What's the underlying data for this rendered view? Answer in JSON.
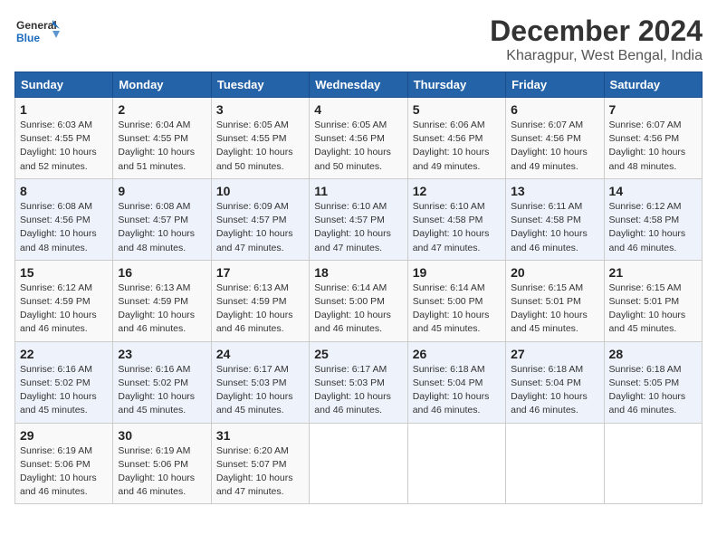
{
  "logo": {
    "line1": "General",
    "line2": "Blue"
  },
  "title": "December 2024",
  "subtitle": "Kharagpur, West Bengal, India",
  "headers": [
    "Sunday",
    "Monday",
    "Tuesday",
    "Wednesday",
    "Thursday",
    "Friday",
    "Saturday"
  ],
  "weeks": [
    [
      {
        "day": "1",
        "sunrise": "6:03 AM",
        "sunset": "4:55 PM",
        "daylight": "10 hours and 52 minutes."
      },
      {
        "day": "2",
        "sunrise": "6:04 AM",
        "sunset": "4:55 PM",
        "daylight": "10 hours and 51 minutes."
      },
      {
        "day": "3",
        "sunrise": "6:05 AM",
        "sunset": "4:55 PM",
        "daylight": "10 hours and 50 minutes."
      },
      {
        "day": "4",
        "sunrise": "6:05 AM",
        "sunset": "4:56 PM",
        "daylight": "10 hours and 50 minutes."
      },
      {
        "day": "5",
        "sunrise": "6:06 AM",
        "sunset": "4:56 PM",
        "daylight": "10 hours and 49 minutes."
      },
      {
        "day": "6",
        "sunrise": "6:07 AM",
        "sunset": "4:56 PM",
        "daylight": "10 hours and 49 minutes."
      },
      {
        "day": "7",
        "sunrise": "6:07 AM",
        "sunset": "4:56 PM",
        "daylight": "10 hours and 48 minutes."
      }
    ],
    [
      {
        "day": "8",
        "sunrise": "6:08 AM",
        "sunset": "4:56 PM",
        "daylight": "10 hours and 48 minutes."
      },
      {
        "day": "9",
        "sunrise": "6:08 AM",
        "sunset": "4:57 PM",
        "daylight": "10 hours and 48 minutes."
      },
      {
        "day": "10",
        "sunrise": "6:09 AM",
        "sunset": "4:57 PM",
        "daylight": "10 hours and 47 minutes."
      },
      {
        "day": "11",
        "sunrise": "6:10 AM",
        "sunset": "4:57 PM",
        "daylight": "10 hours and 47 minutes."
      },
      {
        "day": "12",
        "sunrise": "6:10 AM",
        "sunset": "4:58 PM",
        "daylight": "10 hours and 47 minutes."
      },
      {
        "day": "13",
        "sunrise": "6:11 AM",
        "sunset": "4:58 PM",
        "daylight": "10 hours and 46 minutes."
      },
      {
        "day": "14",
        "sunrise": "6:12 AM",
        "sunset": "4:58 PM",
        "daylight": "10 hours and 46 minutes."
      }
    ],
    [
      {
        "day": "15",
        "sunrise": "6:12 AM",
        "sunset": "4:59 PM",
        "daylight": "10 hours and 46 minutes."
      },
      {
        "day": "16",
        "sunrise": "6:13 AM",
        "sunset": "4:59 PM",
        "daylight": "10 hours and 46 minutes."
      },
      {
        "day": "17",
        "sunrise": "6:13 AM",
        "sunset": "4:59 PM",
        "daylight": "10 hours and 46 minutes."
      },
      {
        "day": "18",
        "sunrise": "6:14 AM",
        "sunset": "5:00 PM",
        "daylight": "10 hours and 46 minutes."
      },
      {
        "day": "19",
        "sunrise": "6:14 AM",
        "sunset": "5:00 PM",
        "daylight": "10 hours and 45 minutes."
      },
      {
        "day": "20",
        "sunrise": "6:15 AM",
        "sunset": "5:01 PM",
        "daylight": "10 hours and 45 minutes."
      },
      {
        "day": "21",
        "sunrise": "6:15 AM",
        "sunset": "5:01 PM",
        "daylight": "10 hours and 45 minutes."
      }
    ],
    [
      {
        "day": "22",
        "sunrise": "6:16 AM",
        "sunset": "5:02 PM",
        "daylight": "10 hours and 45 minutes."
      },
      {
        "day": "23",
        "sunrise": "6:16 AM",
        "sunset": "5:02 PM",
        "daylight": "10 hours and 45 minutes."
      },
      {
        "day": "24",
        "sunrise": "6:17 AM",
        "sunset": "5:03 PM",
        "daylight": "10 hours and 45 minutes."
      },
      {
        "day": "25",
        "sunrise": "6:17 AM",
        "sunset": "5:03 PM",
        "daylight": "10 hours and 46 minutes."
      },
      {
        "day": "26",
        "sunrise": "6:18 AM",
        "sunset": "5:04 PM",
        "daylight": "10 hours and 46 minutes."
      },
      {
        "day": "27",
        "sunrise": "6:18 AM",
        "sunset": "5:04 PM",
        "daylight": "10 hours and 46 minutes."
      },
      {
        "day": "28",
        "sunrise": "6:18 AM",
        "sunset": "5:05 PM",
        "daylight": "10 hours and 46 minutes."
      }
    ],
    [
      {
        "day": "29",
        "sunrise": "6:19 AM",
        "sunset": "5:06 PM",
        "daylight": "10 hours and 46 minutes."
      },
      {
        "day": "30",
        "sunrise": "6:19 AM",
        "sunset": "5:06 PM",
        "daylight": "10 hours and 46 minutes."
      },
      {
        "day": "31",
        "sunrise": "6:20 AM",
        "sunset": "5:07 PM",
        "daylight": "10 hours and 47 minutes."
      },
      null,
      null,
      null,
      null
    ]
  ],
  "labels": {
    "sunrise": "Sunrise: ",
    "sunset": "Sunset: ",
    "daylight": "Daylight: "
  }
}
